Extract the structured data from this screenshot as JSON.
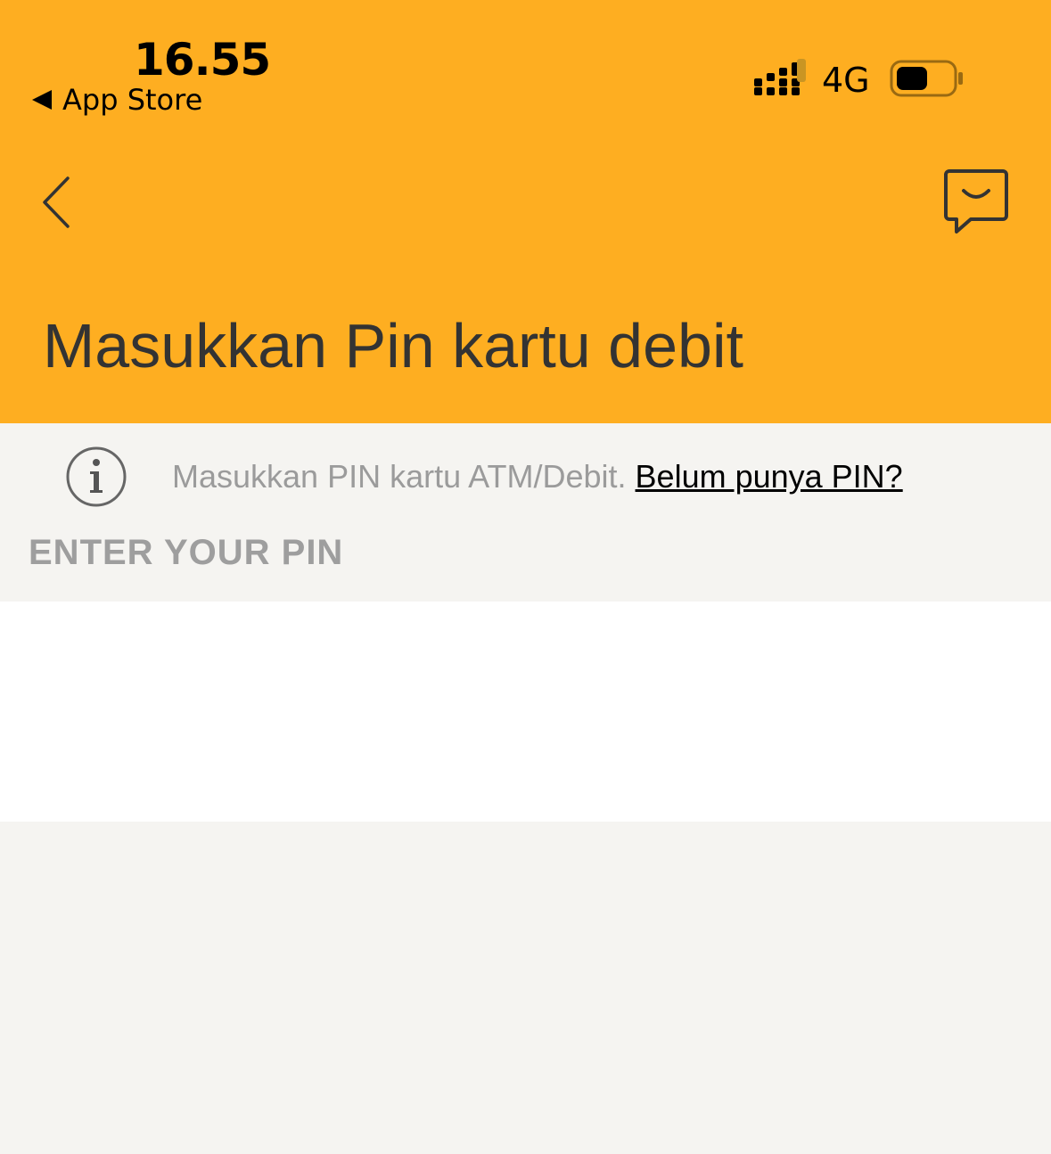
{
  "status_bar": {
    "time": "16.55",
    "back_app": "App Store",
    "network": "4G"
  },
  "header": {
    "title": "Masukkan Pin kartu debit"
  },
  "info": {
    "text": "Masukkan PIN kartu ATM/Debit.",
    "link": "Belum punya PIN?"
  },
  "pin": {
    "label": "ENTER YOUR PIN",
    "value": ""
  },
  "colors": {
    "header_bg": "#feae21",
    "page_bg": "#f5f4f1",
    "title_text": "#333333",
    "muted_text": "#9b9b9b"
  },
  "icons": {
    "back": "chevron-left-icon",
    "chat": "chat-bubble-icon",
    "info": "info-icon",
    "signal": "signal-icon",
    "battery": "battery-icon"
  }
}
